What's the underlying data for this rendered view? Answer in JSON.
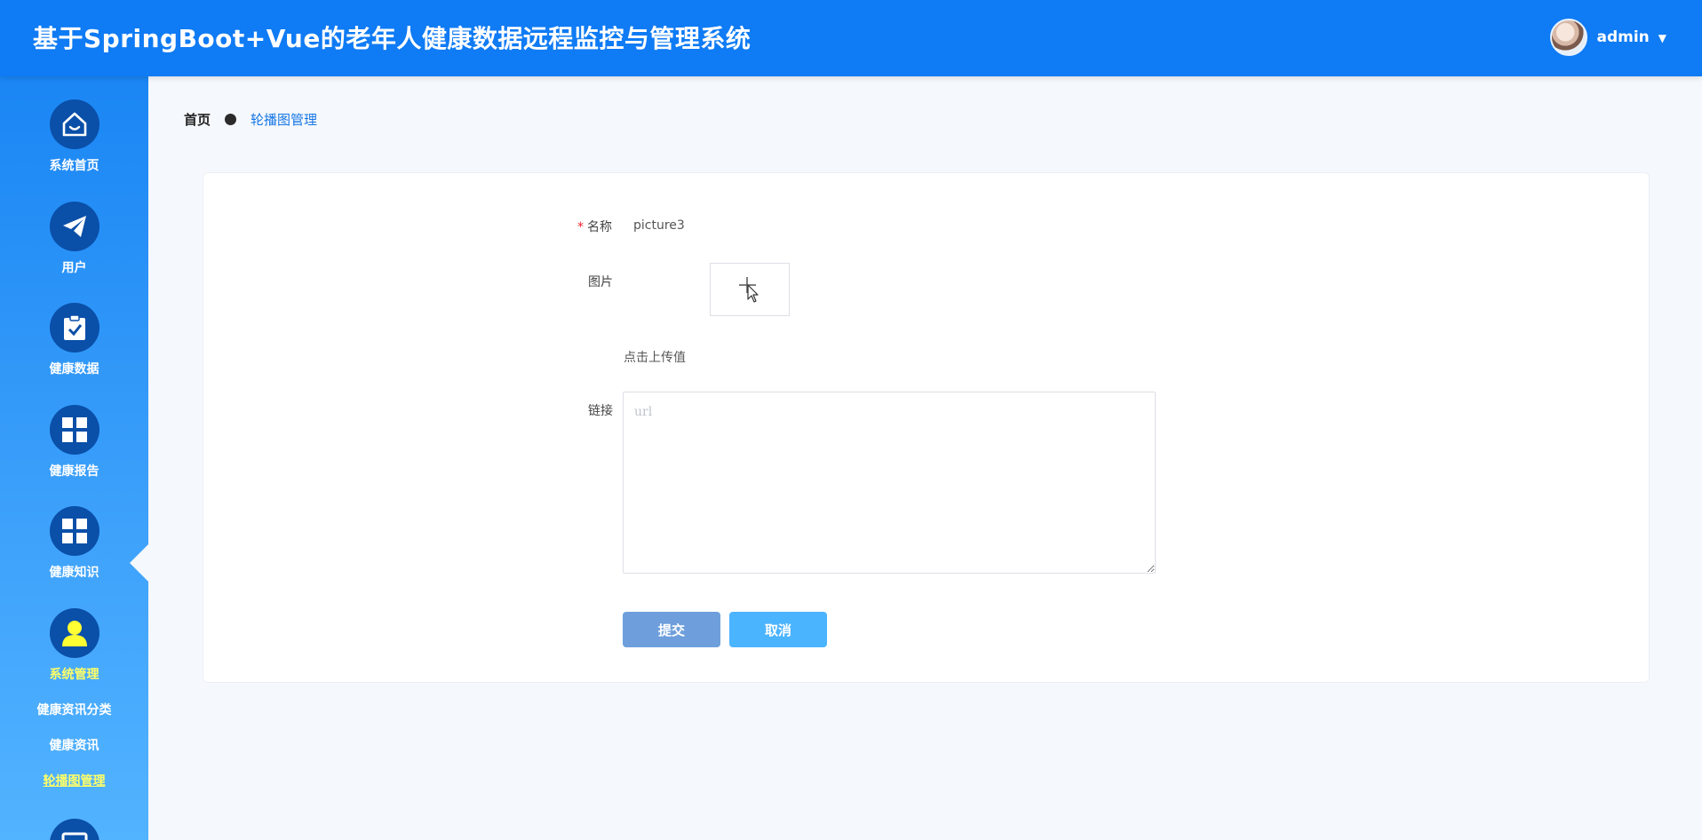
{
  "header": {
    "title": "基于SpringBoot+Vue的老年人健康数据远程监控与管理系统",
    "user_name": "admin",
    "caret": "▼"
  },
  "sidebar": {
    "items": [
      {
        "label": "系统首页",
        "icon": "home-icon"
      },
      {
        "label": "用户",
        "icon": "paper-plane-icon"
      },
      {
        "label": "健康数据",
        "icon": "clipboard-check-icon"
      },
      {
        "label": "健康报告",
        "icon": "grid-icon"
      },
      {
        "label": "健康知识",
        "icon": "grid-icon"
      },
      {
        "label": "系统管理",
        "icon": "user-icon",
        "active": true
      }
    ],
    "sub_items": [
      {
        "label": "健康资讯分类"
      },
      {
        "label": "健康资讯"
      },
      {
        "label": "轮播图管理",
        "active": true
      }
    ]
  },
  "breadcrumb": {
    "home": "首页",
    "current": "轮播图管理"
  },
  "form": {
    "name_label": "名称",
    "name_required_mark": "*",
    "name_value": "picture3",
    "image_label": "图片",
    "upload_hint": "点击上传值",
    "link_label": "链接",
    "link_placeholder": "url",
    "submit_label": "提交",
    "cancel_label": "取消"
  },
  "colors": {
    "header": "#0f7bf4",
    "menu_circle": "#0a4fa8",
    "active_text": "#ffff66",
    "submit": "#6e9fdc",
    "cancel": "#4bb4ff"
  }
}
